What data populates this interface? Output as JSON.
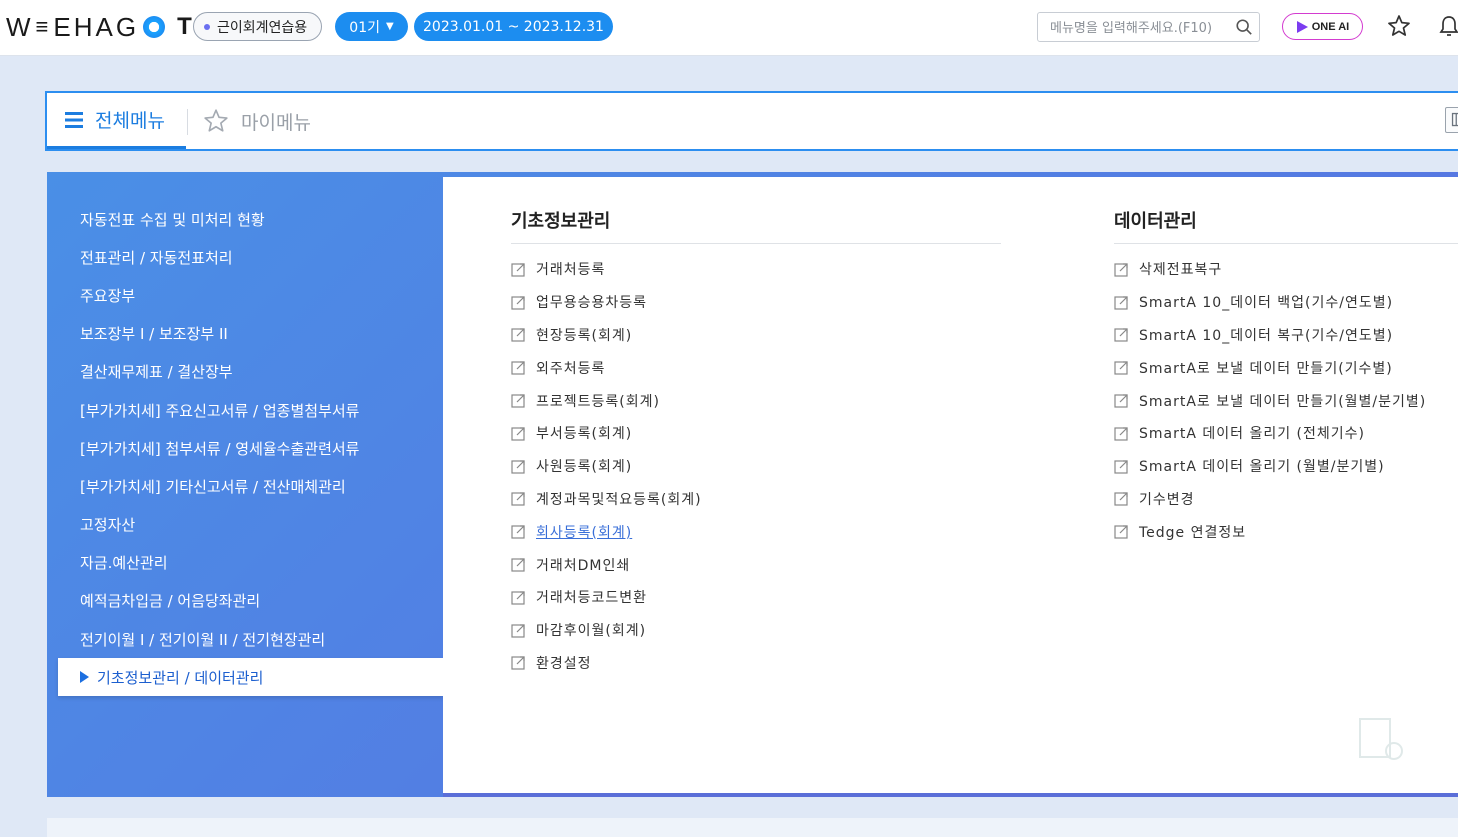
{
  "header": {
    "logo_left": "W",
    "logo_mid": "EHAG",
    "logo_t": "T",
    "company": "근이회계연습용",
    "period": "01기",
    "date_range": "2023.01.01 ~ 2023.12.31",
    "search_placeholder": "메뉴명을 입력해주세요.(F10)",
    "oneai_label": "ONE AI"
  },
  "tabs": {
    "all_menu": "전체메뉴",
    "my_menu": "마이메뉴"
  },
  "left_nav": [
    "자동전표 수집 및 미처리 현황",
    "전표관리 / 자동전표처리",
    "주요장부",
    "보조장부 I / 보조장부 II",
    "결산재무제표 / 결산장부",
    "[부가가치세] 주요신고서류 / 업종별첨부서류",
    "[부가가치세] 첨부서류 / 영세율수출관련서류",
    "[부가가치세] 기타신고서류 / 전산매체관리",
    "고정자산",
    "자금.예산관리",
    "예적금차입금 / 어음당좌관리",
    "전기이월 Ⅰ / 전기이월 II / 전기현장관리",
    "기초정보관리 / 데이터관리"
  ],
  "active_left_index": 12,
  "sections": [
    {
      "title": "기초정보관리",
      "items": [
        "거래처등록",
        "업무용승용차등록",
        "현장등록(회계)",
        "외주처등록",
        "프로젝트등록(회계)",
        "부서등록(회계)",
        "사원등록(회계)",
        "계정과목및적요등록(회계)",
        "회사등록(회계)",
        "거래처DM인쇄",
        "거래처등코드변환",
        "마감후이월(회계)",
        "환경설정"
      ]
    },
    {
      "title": "데이터관리",
      "items": [
        "삭제전표복구",
        "SmartA 10_데이터 백업(기수/연도별)",
        "SmartA 10_데이터 복구(기수/연도별)",
        "SmartA로 보낼 데이터 만들기(기수별)",
        "SmartA로 보낼 데이터 만들기(월별/분기별)",
        "SmartA 데이터 올리기 (전체기수)",
        "SmartA 데이터 올리기 (월별/분기별)",
        "기수변경",
        "Tedge 연결정보"
      ]
    }
  ],
  "hovered_item": "회사등록(회계)",
  "colors": {
    "accent": "#1c8df0",
    "panel_gradient_start": "#4a8fe6",
    "panel_gradient_end": "#5b6ee0",
    "link_hover": "#3a6fd8"
  }
}
